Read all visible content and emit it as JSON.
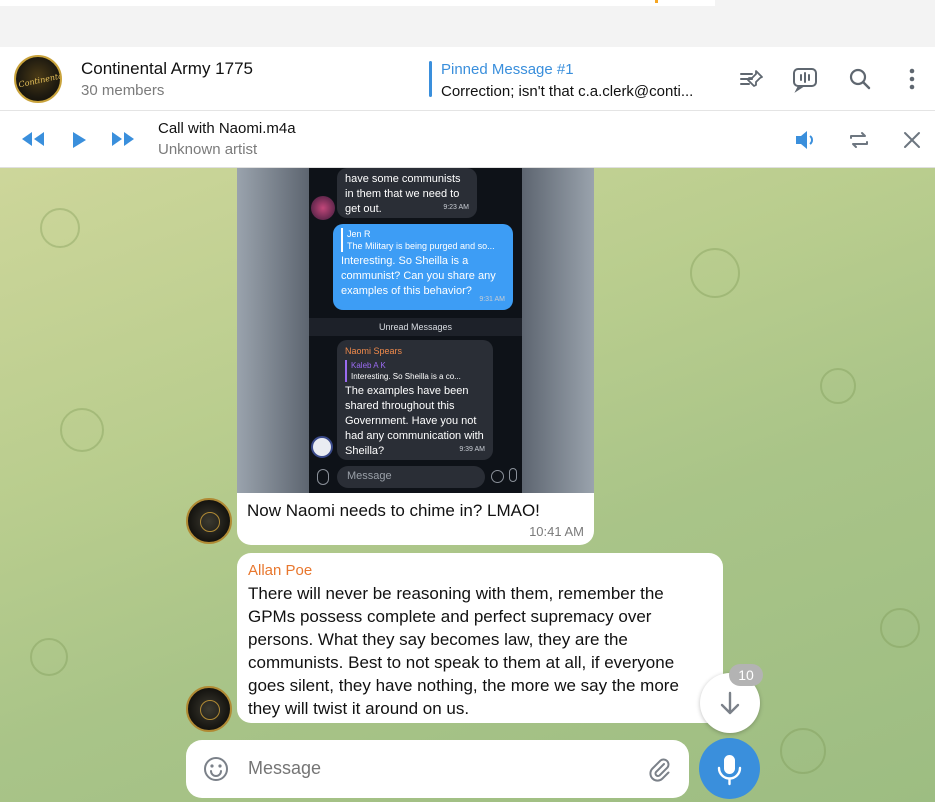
{
  "chat": {
    "title": "Continental Army 1775",
    "members": "30 members",
    "avatar_text": "Continental Army"
  },
  "pinned": {
    "title": "Pinned Message #1",
    "text": "Correction; isn't that c.a.clerk@conti..."
  },
  "header_icons": [
    "pinned-list-icon",
    "video-chat-icon",
    "search-icon",
    "more-vertical-icon"
  ],
  "player": {
    "title": "Call with Naomi.m4a",
    "artist": "Unknown artist",
    "controls": [
      "rewind-icon",
      "play-icon",
      "fast-forward-icon",
      "volume-icon",
      "repeat-icon",
      "close-icon"
    ]
  },
  "screenshot": {
    "msg1": "have some communists in them that we need to get out.",
    "msg1_time": "9:23 AM",
    "reply_name": "Jen R",
    "reply_text": "The Military is being purged and so...",
    "msg2": "Interesting. So Sheilla is a communist? Can you share any examples of this behavior?",
    "msg2_time": "9:31 AM",
    "unread": "Unread Messages",
    "sender": "Naomi Spears",
    "quote_name": "Kaleb A K",
    "quote_text": "Interesting. So Sheilla is a co...",
    "msg3": "The examples have been shared throughout this Government. Have you not had any communication with Sheilla?",
    "msg3_time": "9:39 AM",
    "input_placeholder": "Message"
  },
  "messages": [
    {
      "text": "Now Naomi needs to chime in?  LMAO!",
      "time": "10:41 AM"
    },
    {
      "sender": "Allan Poe",
      "text": "There will never be reasoning with them, remember the GPMs possess complete and perfect supremacy over persons. What they say becomes law, they are the communists. Best to not speak to them at all, if everyone goes silent, they have nothing, the more we say the more they will twist it around on us."
    }
  ],
  "unread_count": "10",
  "composer": {
    "placeholder": "Message"
  },
  "colors": {
    "accent": "#3a8fdc",
    "sender": "#e8772e"
  }
}
